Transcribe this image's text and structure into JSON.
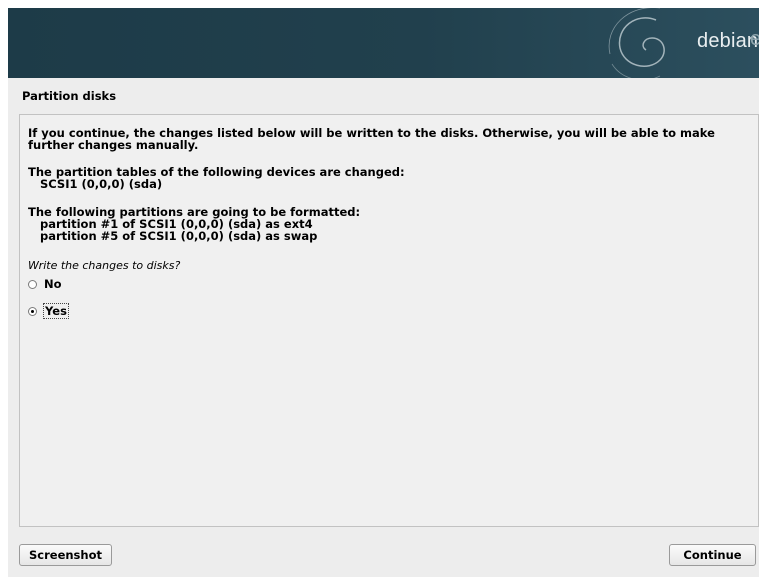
{
  "banner": {
    "logo_text": "debian",
    "logo_trail": "e"
  },
  "page": {
    "title": "Partition disks"
  },
  "body": {
    "intro_line1": "If you continue, the changes listed below will be written to the disks. Otherwise, you will be able to make",
    "intro_line2": "further changes manually.",
    "tables_heading": "The partition tables of the following devices are changed:",
    "tables_items": [
      "SCSI1 (0,0,0) (sda)"
    ],
    "format_heading": "The following partitions are going to be formatted:",
    "format_items": [
      "partition #1 of SCSI1 (0,0,0) (sda) as ext4",
      "partition #5 of SCSI1 (0,0,0) (sda) as swap"
    ],
    "question": "Write the changes to disks?"
  },
  "options": [
    {
      "label": "No",
      "selected": false
    },
    {
      "label": "Yes",
      "selected": true
    }
  ],
  "buttons": {
    "screenshot": "Screenshot",
    "continue": "Continue"
  },
  "colors": {
    "banner": "#21404d",
    "frame": "#ededed",
    "content": "#f0f0f0"
  }
}
